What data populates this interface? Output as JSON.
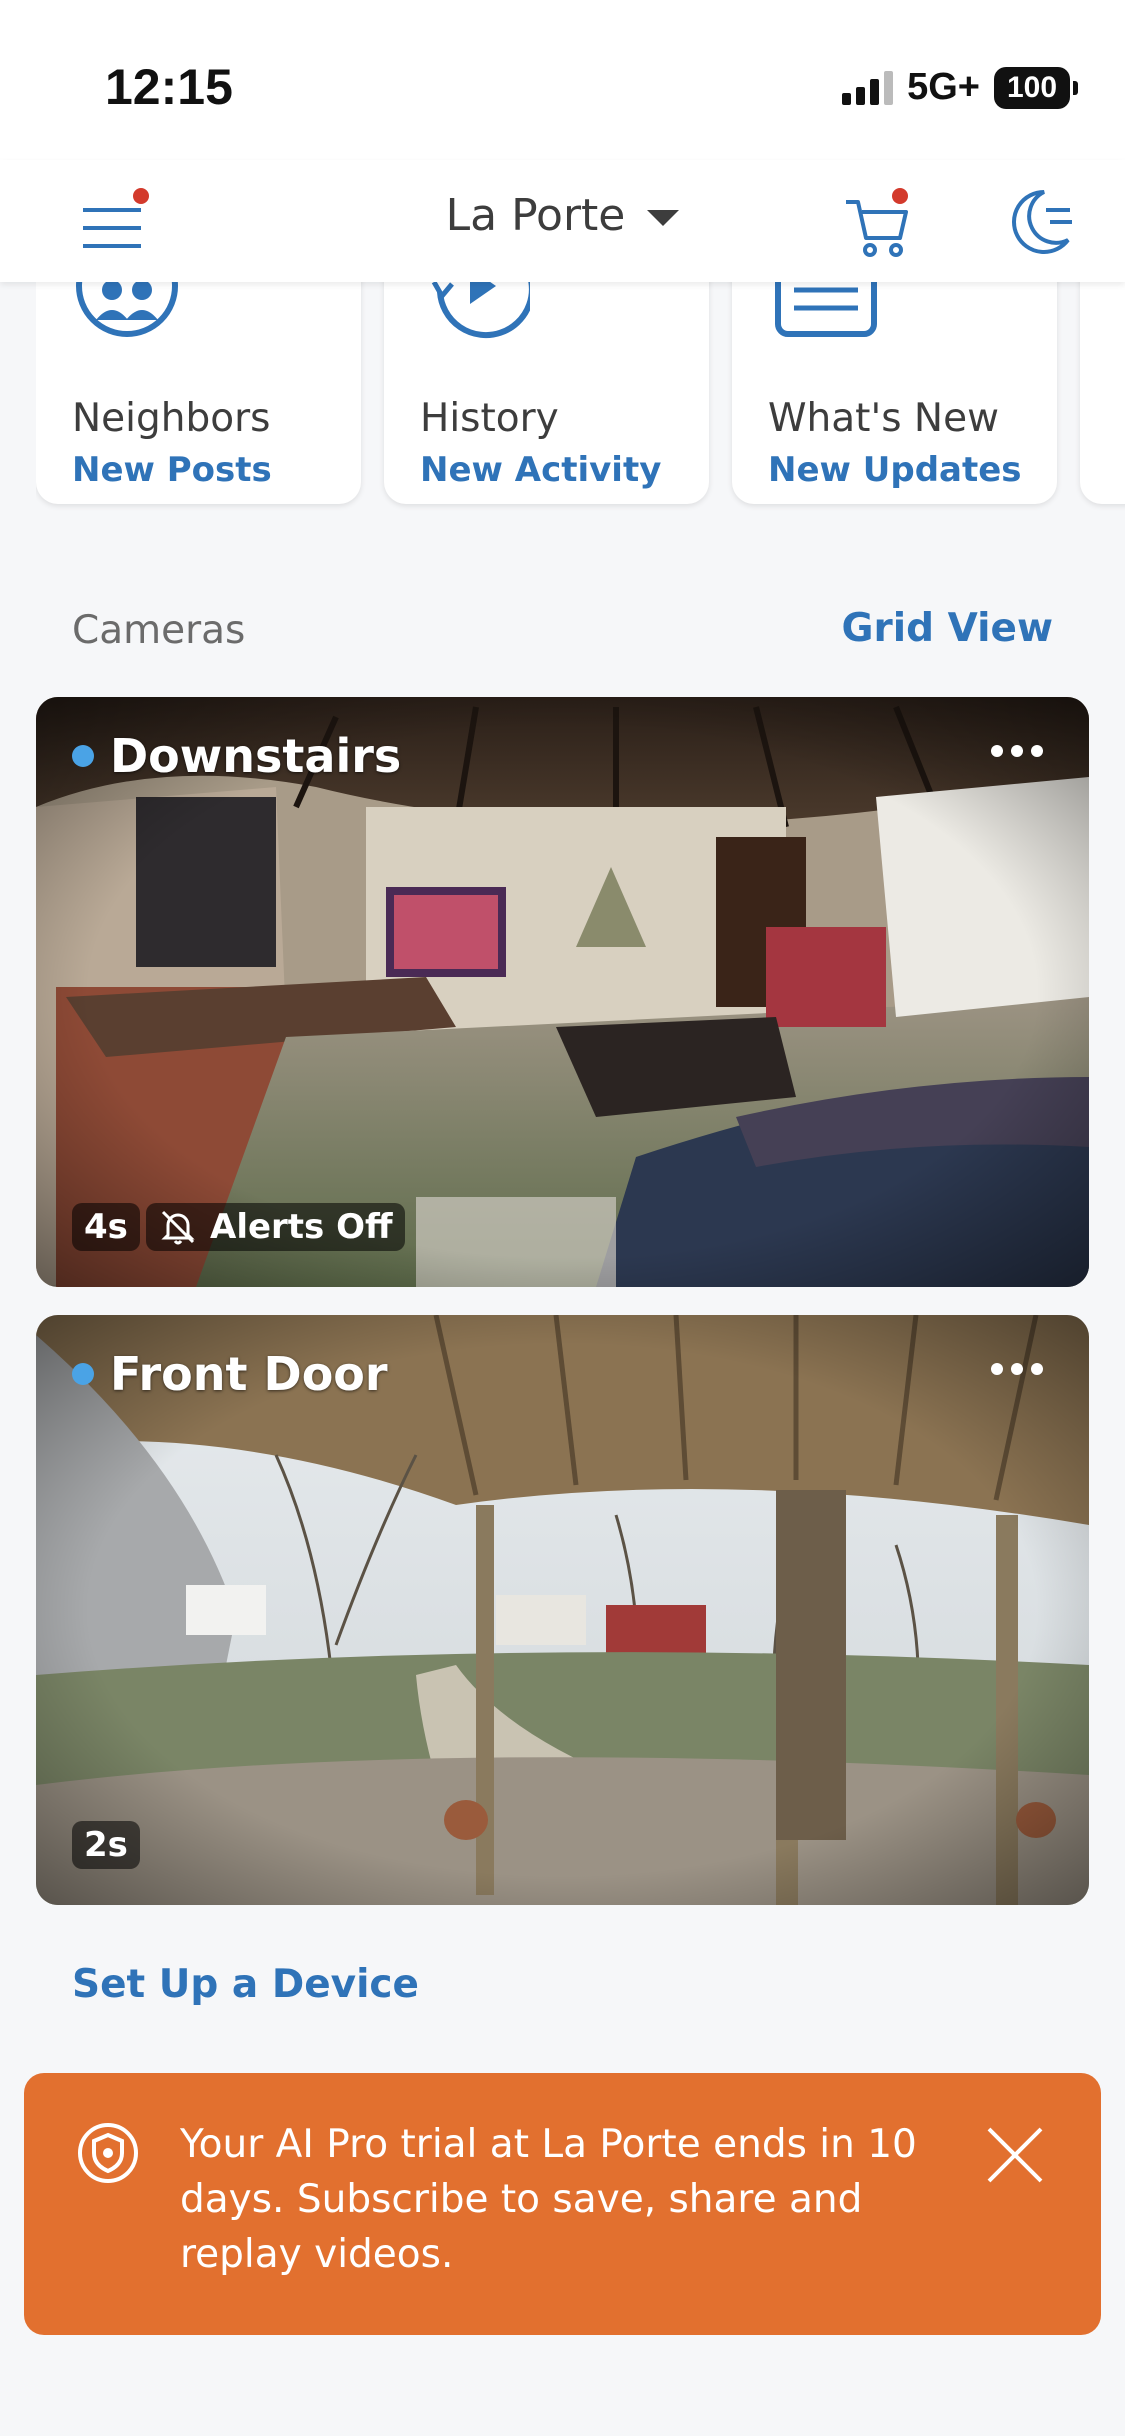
{
  "status_bar": {
    "time": "12:15",
    "network": "5G+",
    "battery": "100"
  },
  "header": {
    "location": "La Porte"
  },
  "tiles": [
    {
      "title": "Neighbors",
      "subtitle": "New Posts"
    },
    {
      "title": "History",
      "subtitle": "New Activity"
    },
    {
      "title": "What's New",
      "subtitle": "New Updates"
    },
    {
      "title": "",
      "subtitle": ""
    }
  ],
  "cameras_section": {
    "title": "Cameras",
    "grid_view": "Grid View"
  },
  "cameras": [
    {
      "name": "Downstairs",
      "age": "4s",
      "alerts": "Alerts Off"
    },
    {
      "name": "Front Door",
      "age": "2s"
    }
  ],
  "setup_link": "Set Up a Device",
  "banner": {
    "text": "Your AI Pro trial at La Porte ends in 10 days. Subscribe to save, share and replay videos."
  },
  "colors": {
    "brand_blue": "#2f73b8",
    "banner_orange": "#e2702f",
    "notification_red": "#d33a2c",
    "live_dot": "#4aa3e6"
  }
}
